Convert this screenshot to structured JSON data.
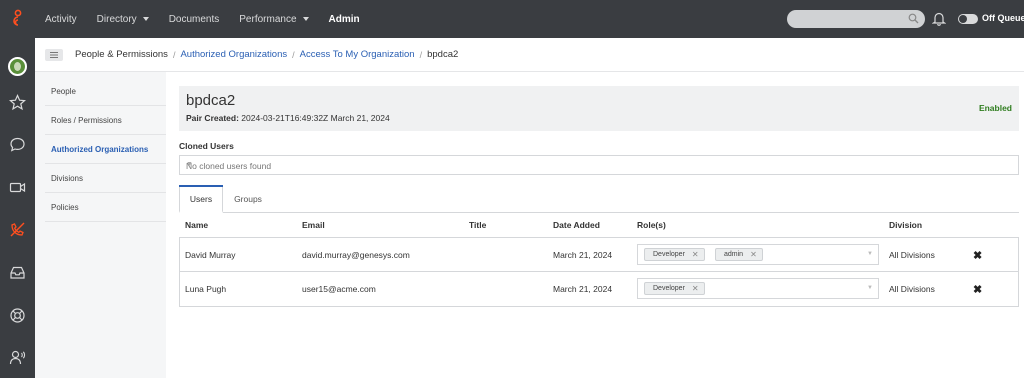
{
  "topnav": {
    "items": [
      {
        "label": "Activity",
        "has_caret": false
      },
      {
        "label": "Directory",
        "has_caret": true
      },
      {
        "label": "Documents",
        "has_caret": false
      },
      {
        "label": "Performance",
        "has_caret": true
      },
      {
        "label": "Admin",
        "has_caret": false,
        "active": true
      }
    ],
    "search_placeholder": "",
    "queue_label": "Off Queue"
  },
  "leftbar": {
    "icons": [
      "avatar",
      "star-icon",
      "chat-icon",
      "video-icon",
      "phone-slash-icon",
      "inbox-icon",
      "help-icon",
      "people-voice-icon"
    ]
  },
  "breadcrumb": {
    "root": "People & Permissions",
    "items": [
      "Authorized Organizations",
      "Access To My Organization"
    ],
    "current": "bpdca2"
  },
  "subnav": {
    "items": [
      {
        "label": "People"
      },
      {
        "label": "Roles / Permissions"
      },
      {
        "label": "Authorized Organizations",
        "active": true
      },
      {
        "label": "Divisions"
      },
      {
        "label": "Policies"
      }
    ]
  },
  "org": {
    "name": "bpdca2",
    "pair_label": "Pair Created:",
    "pair_value": "2024-03-21T16:49:32Z March 21, 2024",
    "status": "Enabled",
    "status_color": "#2f7d1f"
  },
  "cloned": {
    "label": "Cloned Users",
    "value": "No cloned users found"
  },
  "tabs": [
    "Users",
    "Groups"
  ],
  "table": {
    "headers": [
      "Name",
      "Email",
      "Title",
      "Date Added",
      "Role(s)",
      "Division"
    ],
    "rows": [
      {
        "name": "David Murray",
        "email": "david.murray@genesys.com",
        "title": "",
        "date": "March 21, 2024",
        "roles": [
          "Developer",
          "admin"
        ],
        "division": "All Divisions"
      },
      {
        "name": "Luna Pugh",
        "email": "user15@acme.com",
        "title": "",
        "date": "March 21, 2024",
        "roles": [
          "Developer"
        ],
        "division": "All Divisions"
      }
    ]
  },
  "colors": {
    "topbar": "#3a3d41",
    "accent": "#2a5fb3",
    "brand": "#ff4f1f"
  }
}
